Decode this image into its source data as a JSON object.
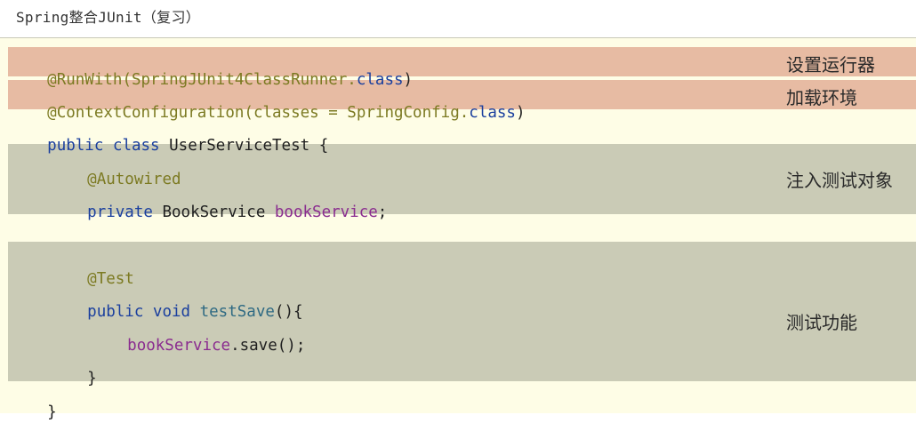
{
  "title": "Spring整合JUnit（复习）",
  "code": {
    "l1": {
      "a": "@RunWith(SpringJUnit4ClassRunner.",
      "b": "class",
      "c": ")"
    },
    "l2": {
      "a": "@ContextConfiguration(classes = SpringConfig.",
      "b": "class",
      "c": ")"
    },
    "l3": {
      "a": "public class",
      "b": " UserServiceTest {"
    },
    "l4": {
      "a": "@Autowired"
    },
    "l5": {
      "a": "private",
      "b": " BookService ",
      "c": "bookService",
      "d": ";"
    },
    "l6": {
      "a": "@Test"
    },
    "l7": {
      "a": "public void",
      "b": " ",
      "c": "testSave",
      "d": "(){"
    },
    "l8": {
      "a": "bookService",
      "b": ".save();"
    },
    "l9": {
      "a": "}"
    },
    "l10": {
      "a": "}"
    }
  },
  "notes": {
    "runner": "设置运行器",
    "env": "加载环境",
    "inject": "注入测试对象",
    "test": "测试功能"
  },
  "colors": {
    "background": "#fefde6",
    "highlight_red": "#e7bba3",
    "highlight_gray": "#cacbb6",
    "keyword": "#1a3f9e",
    "annotation": "#7c7a22",
    "field": "#8a2c8f"
  }
}
